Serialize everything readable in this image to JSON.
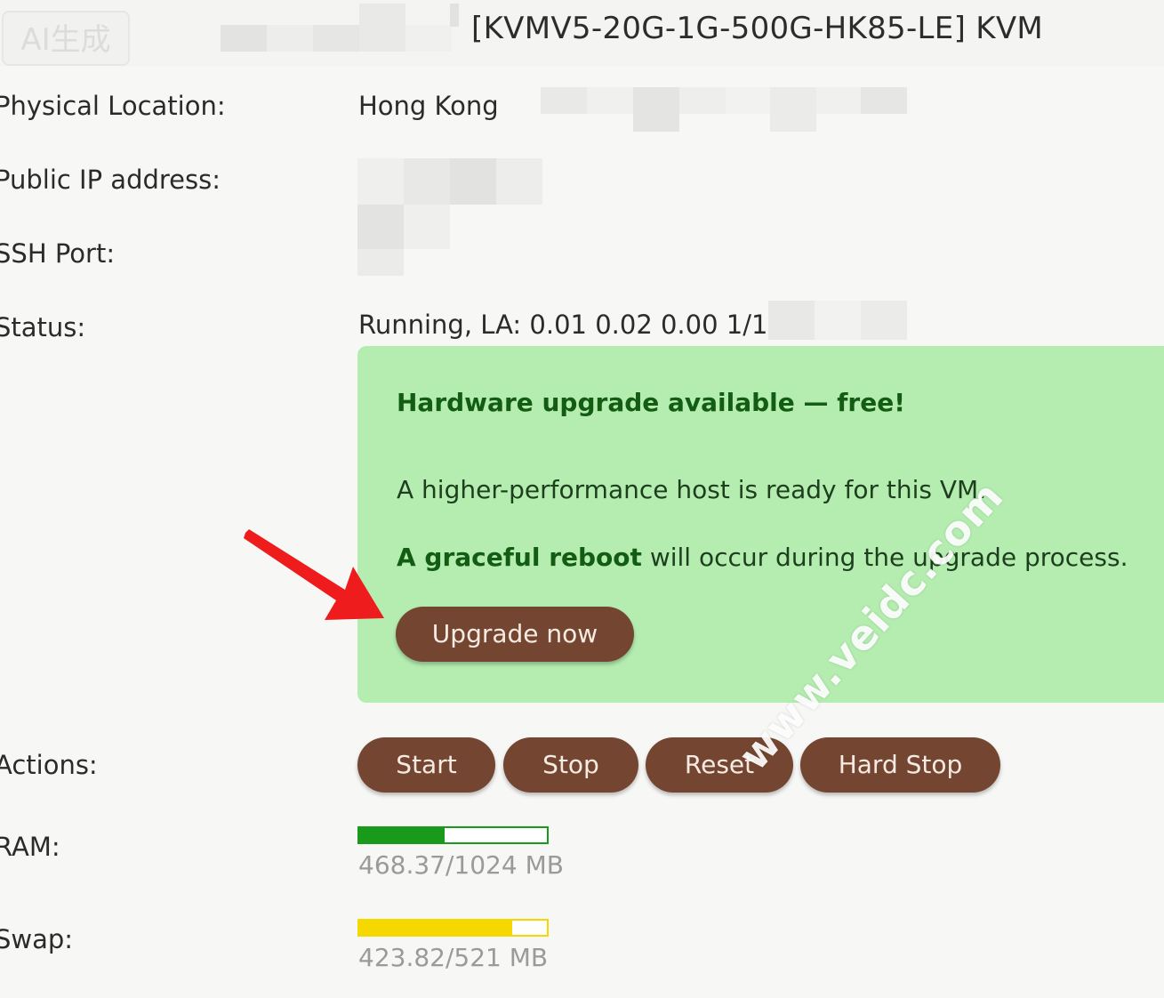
{
  "badge": {
    "text": "AI生成"
  },
  "header": {
    "plan_title": "[KVMV5-20G-1G-500G-HK85-LE]   KVM"
  },
  "details": {
    "location_label": "Physical Location:",
    "location_value": "Hong Kong",
    "ip_label": "Public IP address:",
    "ssh_label": "SSH Port:",
    "status_label": "Status:",
    "status_value": "Running, LA: 0.01 0.02 0.00 1/18e"
  },
  "notice": {
    "title": "Hardware upgrade available — free!",
    "line1": "A higher-performance host is ready for this VM.",
    "line2_bold": "A graceful reboot",
    "line2_rest": " will occur during the upgrade process.",
    "button_label": "Upgrade now"
  },
  "actions": {
    "label": "Actions:",
    "buttons": [
      "Start",
      "Stop",
      "Reset",
      "Hard Stop"
    ]
  },
  "ram": {
    "label": "RAM:",
    "text": "468.37/1024 MB",
    "fraction": 0.457,
    "color": "#1a9a1a"
  },
  "swap": {
    "label": "Swap:",
    "text": "423.82/521 MB",
    "fraction": 0.813,
    "color": "#f5d800"
  },
  "watermark": {
    "text": "www.veidc.com"
  },
  "colors": {
    "notice_bg": "#b5edb1",
    "button_bg": "#744631",
    "accent_green": "#135c13"
  }
}
